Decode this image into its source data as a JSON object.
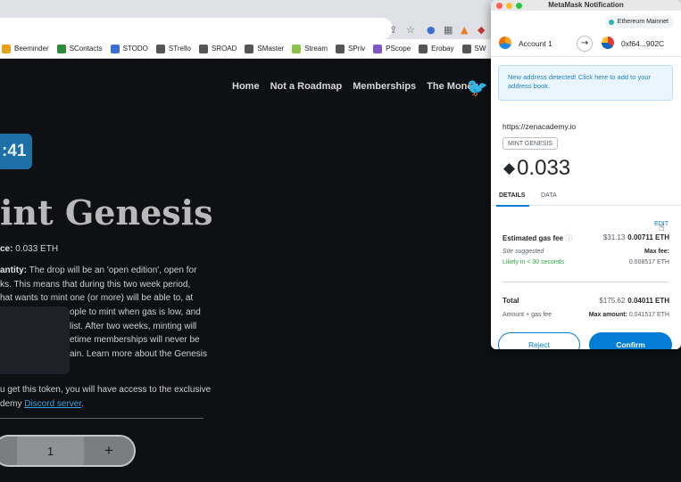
{
  "browser": {
    "bookmarks": [
      {
        "label": "Beeminder",
        "color": "#e6a21a"
      },
      {
        "label": "SContacts",
        "color": "#2e8b3a"
      },
      {
        "label": "STODO",
        "color": "#3b6fd4"
      },
      {
        "label": "STrello",
        "color": "#555555"
      },
      {
        "label": "SROAD",
        "color": "#555555"
      },
      {
        "label": "SMaster",
        "color": "#555555"
      },
      {
        "label": "Stream",
        "color": "#8bc34a"
      },
      {
        "label": "SPriv",
        "color": "#555555"
      },
      {
        "label": "PScope",
        "color": "#7e57c2"
      },
      {
        "label": "Erobay",
        "color": "#555555"
      },
      {
        "label": "SW",
        "color": "#555555"
      }
    ]
  },
  "site": {
    "nav": [
      "Home",
      "Not a Roadmap",
      "Memberships",
      "The Money"
    ],
    "timer": ":41",
    "title": "int Genesis",
    "price_label": "ce:",
    "price_value": "0.033 ETH",
    "quantity_label": "antity:",
    "para_lines": [
      "The drop will be an 'open edition', open for",
      "ks. This means that during this two week period,",
      "hat wants to mint one (or more) will be able to, at",
      "ople to mint when gas is low, and",
      "list. After two weeks, minting will",
      "etime memberships will never be",
      "ain. Learn more about the Genesis"
    ],
    "para2_line1": "u get this token, you will have access to the exclusive",
    "para2_line2_prefix": "demy",
    "discord_link": "Discord server",
    "para2_suffix": ".",
    "quantity": "1",
    "plus": "+"
  },
  "metamask": {
    "window_title": "MetaMask Notification",
    "network": "Ethereum Mainnet",
    "from_account": "Account 1",
    "to_address": "0xf64...902C",
    "notice": "New address detected! Click here to add to your address book.",
    "origin": "https://zenacademy.io",
    "method": "MINT GENESIS",
    "amount": "0.033",
    "tabs": [
      "DETAILS",
      "DATA"
    ],
    "edit": "EDIT",
    "gas_label": "Estimated gas fee",
    "gas_usd": "$31.13",
    "gas_eth": "0.00711 ETH",
    "site_suggested": "Site suggested",
    "max_fee_label": "Max fee:",
    "likely": "Likely in < 30 seconds",
    "max_fee_value": "0.008517 ETH",
    "total_label": "Total",
    "total_usd": "$175.62",
    "total_eth": "0.04011 ETH",
    "amount_gas_label": "Amount + gas fee",
    "max_amount_label": "Max amount:",
    "max_amount_value": "0.041517 ETH",
    "reject": "Reject",
    "confirm": "Confirm",
    "accent": "#037dd6"
  }
}
